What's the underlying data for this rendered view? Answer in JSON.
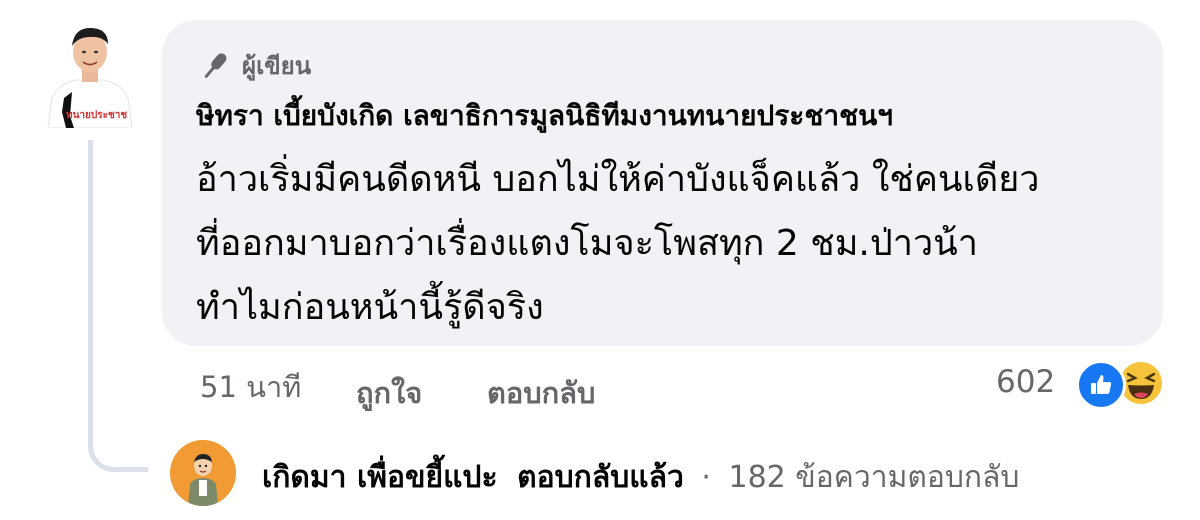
{
  "comment": {
    "badge_label": "ผู้เขียน",
    "badge_icon": "microphone-icon",
    "author_name": "ษิทรา เบี้ยบังเกิด เลขาธิการมูลนิธิทีมงานทนายประชาชนฯ",
    "text_lines": [
      "อ้าวเริ่มมีคนดีดหนี บอกไม่ให้ค่าบังแจ็คแล้ว ใช่คนเดียว",
      "ที่ออกมาบอกว่าเรื่องแตงโมจะโพสทุก 2 ชม.ป่าวน้า",
      "ทำไมก่อนหน้านี้รู้ดีจริง"
    ],
    "avatar_shirt_text": "ทนายประชาช",
    "bubble_color": "#f0f2f5"
  },
  "actions": {
    "time": "51 นาที",
    "like_label": "ถูกใจ",
    "reply_label": "ตอบกลับ",
    "reaction_count": "602",
    "reaction_icons": [
      "like-icon",
      "haha-icon"
    ],
    "like_color": "#1877f2"
  },
  "reply_summary": {
    "author": "เกิดมา เพื่อขยี้แปะ",
    "verb": "ตอบกลับแล้ว",
    "separator": "·",
    "count_text": "182 ข้อความตอบกลับ",
    "avatar_color": "#f29a33"
  }
}
